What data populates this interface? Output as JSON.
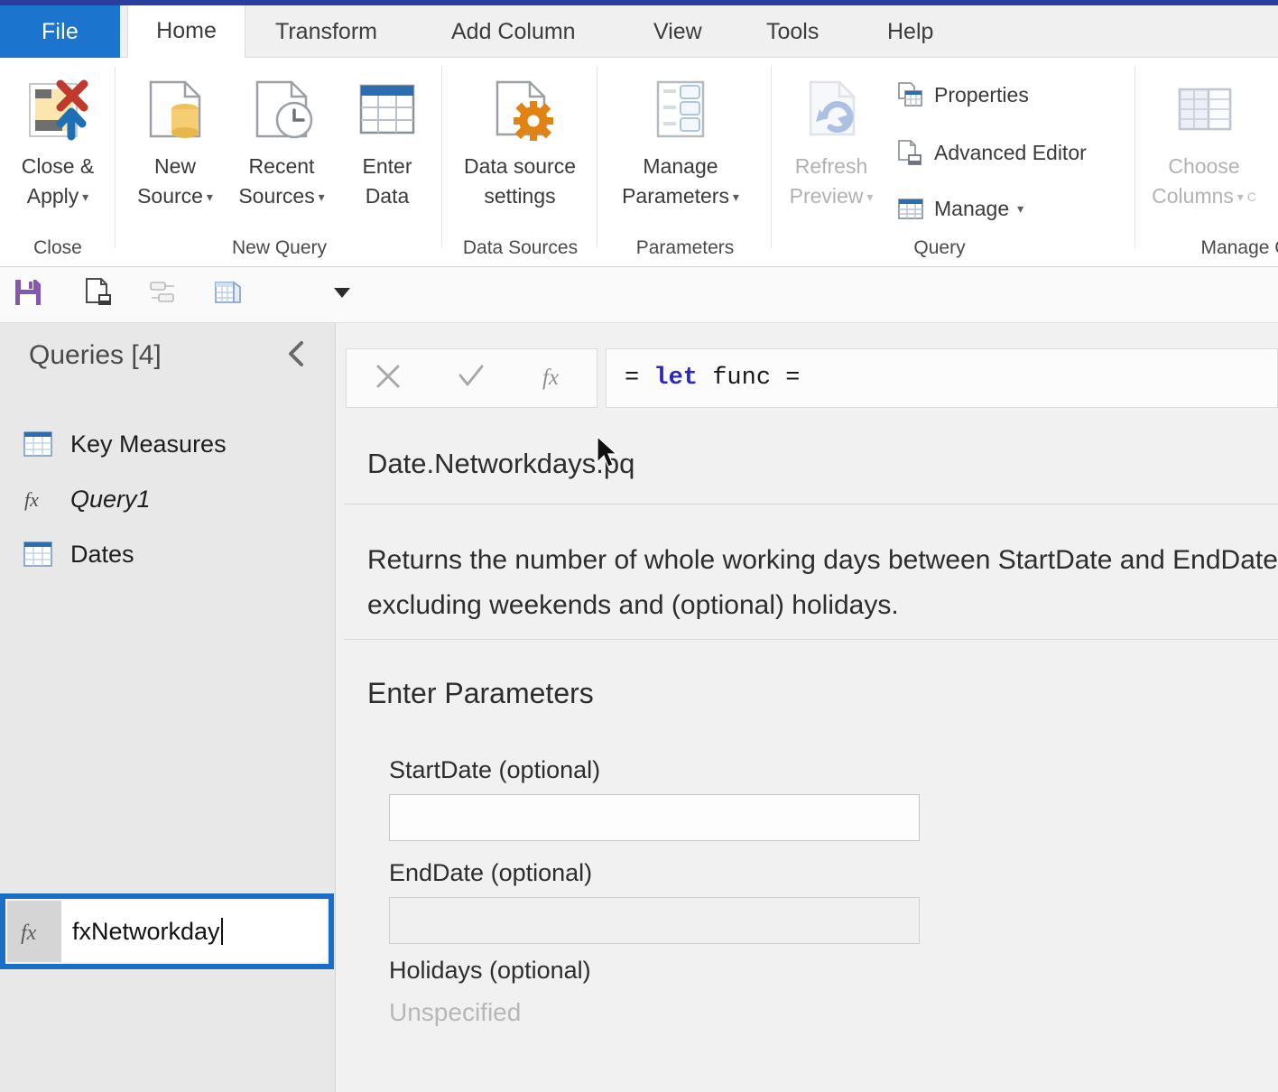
{
  "window": {
    "accent_color": "#1b75ce",
    "title_strip_color": "#2a3f9d"
  },
  "tabs": [
    {
      "label": "File",
      "icon": "file-tab",
      "active": false,
      "is_file": true
    },
    {
      "label": "Home",
      "active": true
    },
    {
      "label": "Transform",
      "active": false
    },
    {
      "label": "Add Column",
      "active": false
    },
    {
      "label": "View",
      "active": false
    },
    {
      "label": "Tools",
      "active": false
    },
    {
      "label": "Help",
      "active": false
    }
  ],
  "ribbon": {
    "groups": [
      {
        "title": "Close",
        "buttons": [
          {
            "label": "Close &\nApply",
            "icon": "close-and-apply-icon",
            "caret": true,
            "disabled": false
          }
        ]
      },
      {
        "title": "New Query",
        "buttons": [
          {
            "label": "New\nSource",
            "icon": "new-source-icon",
            "caret": true,
            "disabled": false
          },
          {
            "label": "Recent\nSources",
            "icon": "recent-sources-icon",
            "caret": true,
            "disabled": false
          },
          {
            "label": "Enter\nData",
            "icon": "enter-data-icon",
            "caret": false,
            "disabled": false
          }
        ]
      },
      {
        "title": "Data Sources",
        "buttons": [
          {
            "label": "Data source\nsettings",
            "icon": "data-source-settings-icon",
            "caret": false,
            "disabled": false
          }
        ]
      },
      {
        "title": "Parameters",
        "buttons": [
          {
            "label": "Manage\nParameters",
            "icon": "manage-parameters-icon",
            "caret": true,
            "disabled": false
          }
        ]
      },
      {
        "title": "Query",
        "buttons": [
          {
            "label": "Refresh\nPreview",
            "icon": "refresh-preview-icon",
            "caret": true,
            "disabled": true
          }
        ],
        "small_buttons": [
          {
            "label": "Properties",
            "icon": "properties-icon"
          },
          {
            "label": "Advanced Editor",
            "icon": "advanced-editor-icon"
          },
          {
            "label": "Manage",
            "icon": "manage-icon",
            "caret": true
          }
        ]
      },
      {
        "title": "Manage C",
        "buttons": [
          {
            "label": "Choose\nColumns",
            "icon": "choose-columns-icon",
            "caret": true,
            "disabled": true
          }
        ]
      }
    ]
  },
  "quick_access": {
    "items": [
      {
        "icon": "save-icon",
        "name": "save"
      },
      {
        "icon": "apply-changes-icon",
        "name": "apply-changes"
      },
      {
        "icon": "merge-queries-icon",
        "name": "merge-queries"
      },
      {
        "icon": "table-icon",
        "name": "new-table"
      }
    ],
    "overflow": {
      "icon": "chevron-down-icon"
    }
  },
  "queries_pane": {
    "title": "Queries [4]",
    "collapse_icon": "chevron-left-icon",
    "items": [
      {
        "label": "Key Measures",
        "icon": "table-icon",
        "italic": false,
        "editing": false
      },
      {
        "label": "Query1",
        "icon": "fx-icon",
        "italic": true,
        "editing": false
      },
      {
        "label": "Dates",
        "icon": "table-icon",
        "italic": false,
        "editing": false
      },
      {
        "label": "fxNetworkday",
        "icon": "fx-icon",
        "italic": false,
        "editing": true
      }
    ],
    "edit_highlight_color": "#1a6fc4"
  },
  "formula_bar": {
    "cancel_icon": "close-icon",
    "accept_icon": "check-icon",
    "fx_icon": "fx-icon",
    "prefix": "=",
    "keyword": "let",
    "rest": "func ="
  },
  "function_view": {
    "title": "Date.Networkdays.pq",
    "description": "Returns the number of whole working days between StartDate and EndDate, excluding weekends and (optional) holidays.",
    "section_title": "Enter Parameters",
    "parameters": [
      {
        "label": "StartDate (optional)",
        "value": "",
        "type": "text",
        "disabled": false
      },
      {
        "label": "EndDate (optional)",
        "value": "",
        "type": "text",
        "disabled": true
      },
      {
        "label": "Holidays (optional)",
        "value": "Unspecified",
        "type": "unspecified",
        "disabled": true
      }
    ]
  }
}
